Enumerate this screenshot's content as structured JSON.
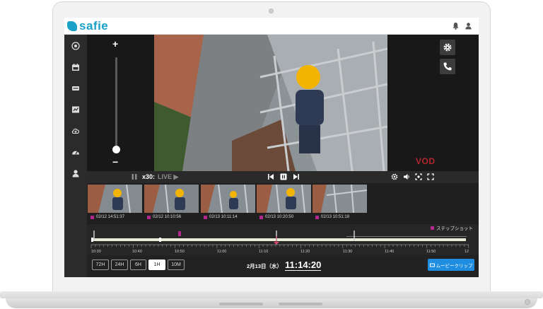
{
  "app": {
    "logo_text": "safie"
  },
  "zoom": {
    "plus": "+",
    "minus": "−"
  },
  "player": {
    "speed": "x30:",
    "live": "LIVE ▶",
    "vod": "VOD"
  },
  "thumbnails": [
    {
      "label": "02/12 14:51:37"
    },
    {
      "label": "02/12 10:10:56"
    },
    {
      "label": "02/13 10:11:14"
    },
    {
      "label": "02/13 10:20:50"
    },
    {
      "label": "02/13 10:51:18"
    }
  ],
  "timeline": {
    "snapshot_label": "ステップショット",
    "tick_labels": [
      "10:30",
      "10:40",
      "10:50",
      "11:00",
      "11:10",
      "11:20",
      "11:30",
      "11:40",
      "11:50",
      "12"
    ]
  },
  "range_buttons": [
    "72H",
    "24H",
    "6H",
    "1H",
    "10M"
  ],
  "range_selected": "1H",
  "clock": {
    "date": "2月13日（水）",
    "time": "11:14:20"
  },
  "movie_clip_label": "ムービークリップ",
  "colors": {
    "brand": "#1ba0c8",
    "vod": "#b3262b",
    "accent_button": "#1f8ee0",
    "marker": "#b2288f"
  }
}
